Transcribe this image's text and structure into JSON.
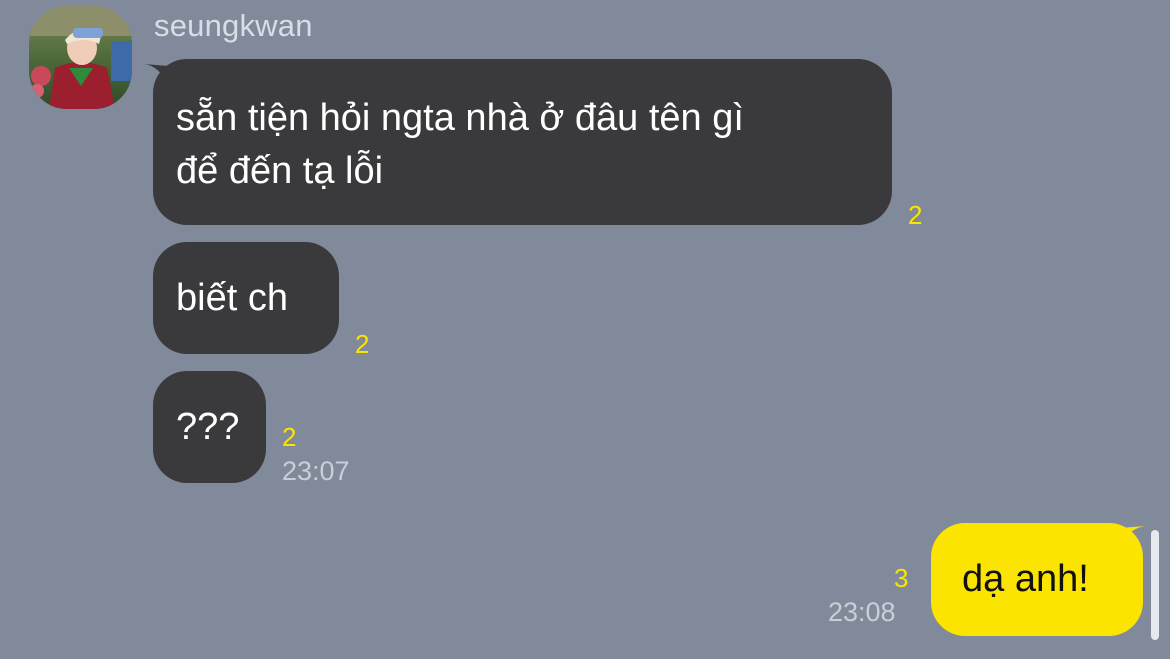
{
  "conversation": {
    "sender_name": "seungkwan",
    "incoming": [
      {
        "text": "sẵn tiện hỏi ngta nhà ở đâu tên gì\nđể đến tạ lỗi",
        "unread": "2"
      },
      {
        "text": "biết ch",
        "unread": "2"
      },
      {
        "text": "???",
        "unread": "2",
        "time": "23:07"
      }
    ],
    "outgoing": [
      {
        "text": "dạ anh!",
        "unread": "3",
        "time": "23:08"
      }
    ]
  },
  "colors": {
    "background": "#808a9a",
    "incoming_bubble": "#3a3a3c",
    "outgoing_bubble": "#fbe400",
    "unread_count": "#fbe400"
  }
}
